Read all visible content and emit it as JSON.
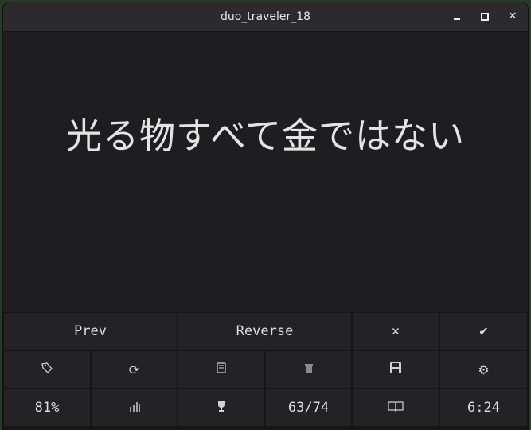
{
  "window": {
    "title": "duo_traveler_18",
    "controls": {
      "minimize": "minimize-icon",
      "maximize": "maximize-icon",
      "close": "close-icon"
    }
  },
  "card": {
    "text": "光る物すべて金ではない"
  },
  "buttons": {
    "prev": "Prev",
    "reverse": "Reverse",
    "wrong": "✕",
    "correct": "✔"
  },
  "tools": {
    "tag": "tag-icon",
    "redo": "redo-icon",
    "scroll": "scroll-icon",
    "delete": "trash-icon",
    "save": "save-icon",
    "settings": "gear-icon"
  },
  "status": {
    "accuracy": "81%",
    "chart": "stats-chart-icon",
    "trophy": "trophy-icon",
    "progress": "63/74",
    "book": "book-icon",
    "time": "6:24"
  }
}
